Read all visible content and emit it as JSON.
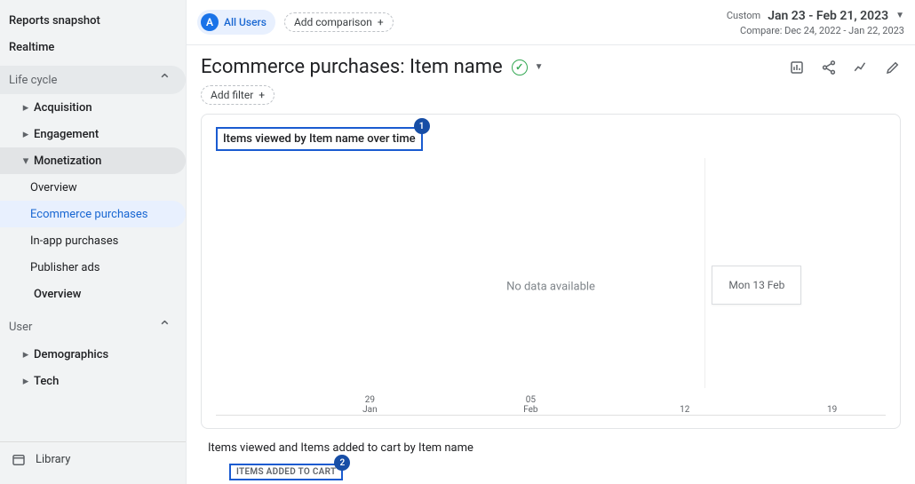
{
  "sidebar": {
    "reports_snapshot": "Reports snapshot",
    "realtime": "Realtime",
    "life_cycle": "Life cycle",
    "acquisition": "Acquisition",
    "engagement": "Engagement",
    "monetization": "Monetization",
    "mon_overview": "Overview",
    "mon_ecommerce": "Ecommerce purchases",
    "mon_inapp": "In-app purchases",
    "mon_pub": "Publisher ads",
    "lc_overview": "Overview",
    "user_section": "User",
    "demographics": "Demographics",
    "tech": "Tech",
    "library": "Library"
  },
  "topbar": {
    "chip_letter": "A",
    "all_users": "All Users",
    "add_comparison": "Add comparison",
    "plus": "+"
  },
  "date": {
    "custom": "Custom",
    "range": "Jan 23 - Feb 21, 2023",
    "compare": "Compare: Dec 24, 2022 - Jan 22, 2023"
  },
  "header": {
    "title": "Ecommerce purchases: Item name"
  },
  "filter": {
    "add_filter": "Add filter"
  },
  "card1": {
    "title": "Items viewed by Item name over time",
    "badge": "1",
    "nodata": "No data available",
    "tooltip": "Mon 13 Feb",
    "xticks": [
      {
        "pct": 23,
        "d1": "29",
        "d2": "Jan"
      },
      {
        "pct": 47,
        "d1": "05",
        "d2": "Feb"
      },
      {
        "pct": 70,
        "d1": "12",
        "d2": ""
      },
      {
        "pct": 92,
        "d1": "19",
        "d2": ""
      }
    ],
    "tooltip_tick_pct": 73
  },
  "card2": {
    "title": "Items viewed and Items added to cart by Item name",
    "col_header": "ITEMS ADDED TO CART",
    "badge": "2"
  },
  "chart_data": {
    "type": "line",
    "title": "Items viewed by Item name over time",
    "xlabel": "",
    "ylabel": "",
    "x": [
      "29 Jan",
      "05 Feb",
      "12 Feb",
      "19 Feb"
    ],
    "series": [],
    "note": "No data available"
  }
}
